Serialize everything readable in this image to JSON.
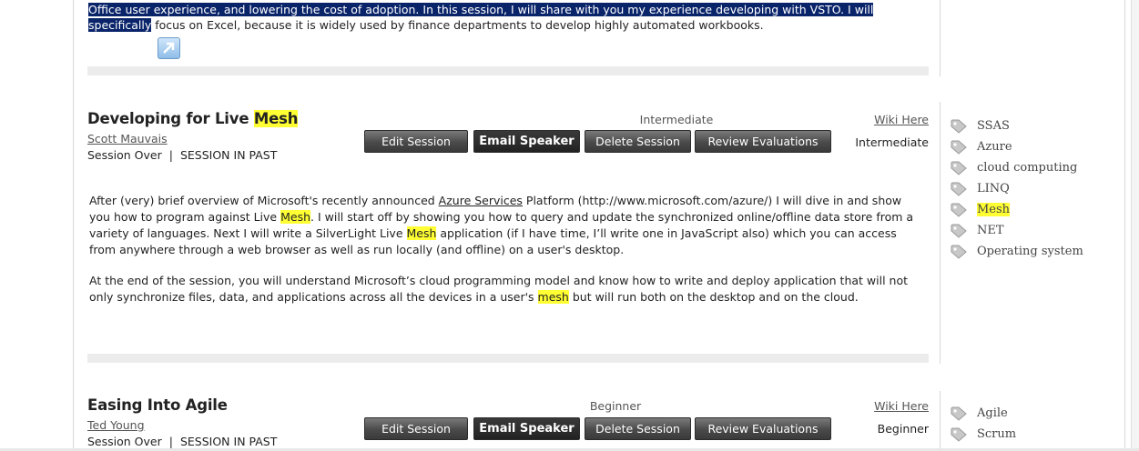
{
  "prev_session": {
    "desc_selected_1": "Office user experience, and lowering the cost of adoption. In this session, I will share with you my experience developing with VSTO. I will",
    "desc_selected_2": "specifically",
    "desc_rest": " focus on Excel, because it is widely used by finance departments to develop highly automated workbooks."
  },
  "buttons": {
    "edit": "Edit Session",
    "email": "Email Speaker",
    "delete": "Delete Session",
    "review": "Review Evaluations"
  },
  "sessions": [
    {
      "title_pre": "Developing for Live ",
      "title_hl": "Mesh",
      "speaker": "Scott Mauvais",
      "status": "Session Over",
      "status2": "SESSION IN PAST",
      "level": "Intermediate",
      "wiki": "Wiki Here",
      "level_right": "Intermediate",
      "desc": {
        "p1_a": "After (very) brief overview of Microsoft's recently announced ",
        "p1_link": "Azure Services",
        "p1_b": " Platform (http://www.microsoft.com/azure/) I will dive in and show you how to program against Live ",
        "p1_hl1": "Mesh",
        "p1_c": ". I will start off by showing you how to query and update the synchronized online/offline data store from a variety of languages. Next I will write a SilverLight Live ",
        "p1_hl2": "Mesh",
        "p1_d": " application (if I have time, I’ll write one in JavaScript also) which you can access from anywhere through a web browser as well as run locally (and offline) on a user's desktop.",
        "p2_a": "At the end of the session, you will understand Microsoft’s cloud programming model and know how to write and deploy application that will not only synchronize files, data, and applications across all the devices in a user's ",
        "p2_hl": "mesh",
        "p2_b": " but will run both on the desktop and on the cloud."
      },
      "tags": [
        "SSAS",
        "Azure",
        "cloud computing",
        "LINQ",
        "Mesh",
        "NET",
        "Operating system"
      ]
    },
    {
      "title": "Easing Into Agile",
      "speaker": "Ted Young",
      "status": "Session Over",
      "status2": "SESSION IN PAST",
      "level": "Beginner",
      "wiki": "Wiki Here",
      "level_right": "Beginner",
      "tags": [
        "Agile",
        "Scrum"
      ]
    }
  ],
  "colors": {
    "highlight": "#ffff33",
    "selection": "#0a246a",
    "button": "#4a4a4a"
  },
  "icons": {
    "tag": "tag-icon",
    "expand": "expand-arrow-icon"
  }
}
